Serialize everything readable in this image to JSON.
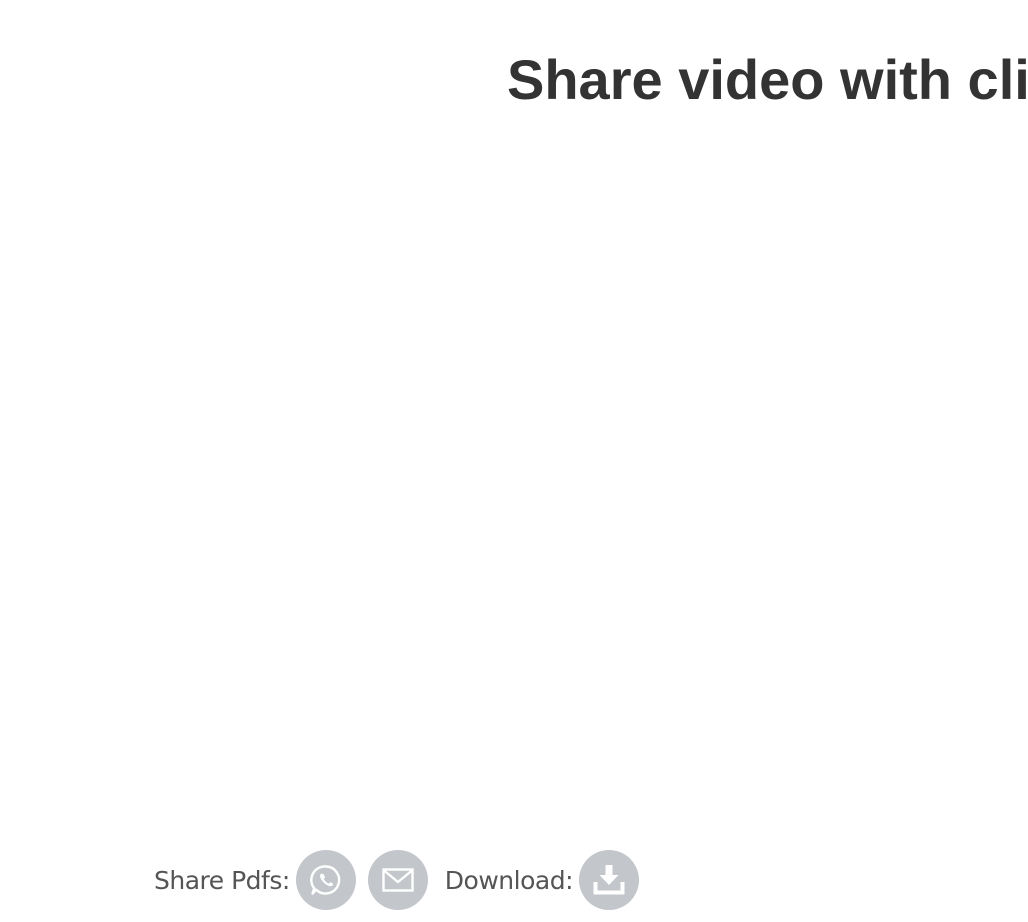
{
  "header": {
    "title": "Share video with cli"
  },
  "share_bar": {
    "share_label": "Share Pdfs:",
    "download_label": "Download:",
    "icons": [
      "whatsapp-icon",
      "mail-icon",
      "download-icon"
    ],
    "icon_bg_color": "#c3c6cb",
    "icon_fg_color": "#ffffff"
  }
}
